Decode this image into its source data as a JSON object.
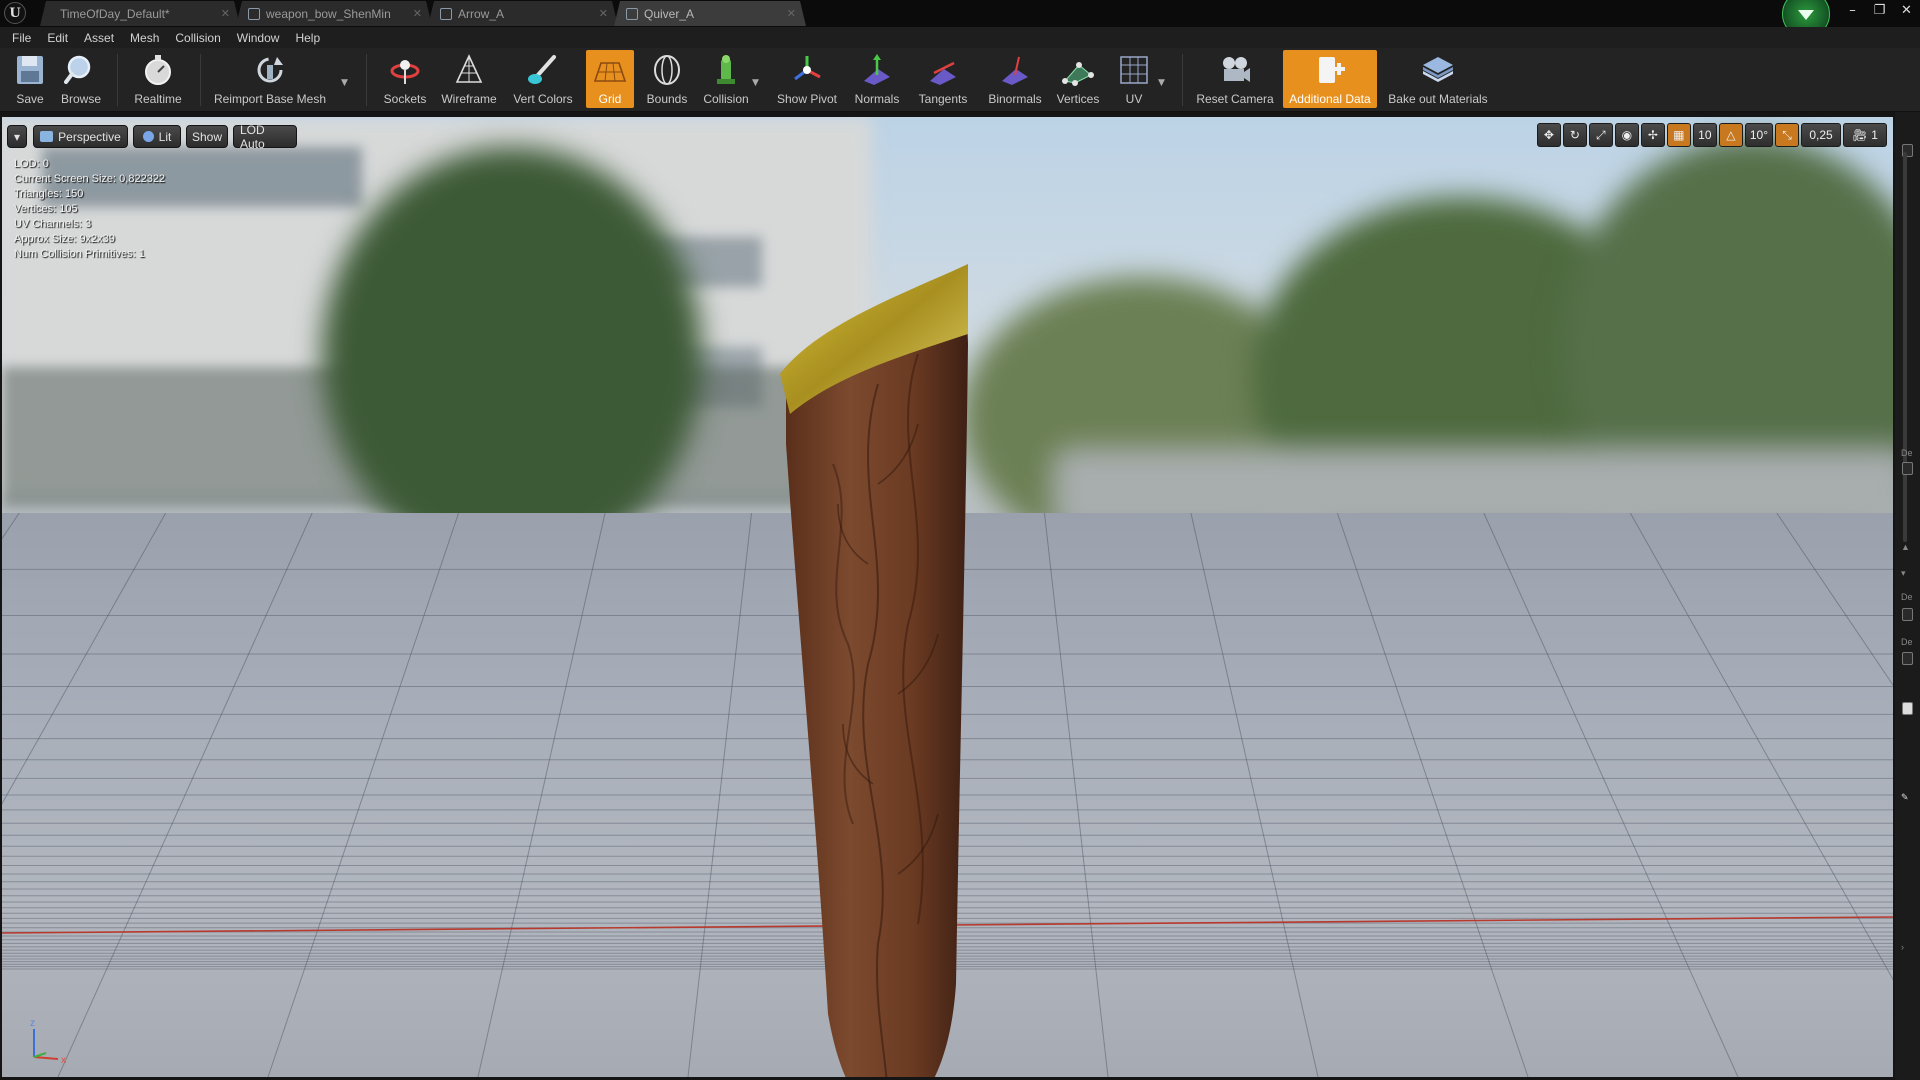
{
  "tabs": [
    {
      "label": "TimeOfDay_Default*",
      "active": false
    },
    {
      "label": "weapon_bow_ShenMin",
      "active": false
    },
    {
      "label": "Arrow_A",
      "active": false
    },
    {
      "label": "Quiver_A",
      "active": true
    }
  ],
  "window_controls": {
    "minimize": "–",
    "restore": "❐",
    "close": "✕"
  },
  "menu": [
    "File",
    "Edit",
    "Asset",
    "Mesh",
    "Collision",
    "Window",
    "Help"
  ],
  "toolbar": {
    "save": "Save",
    "browse": "Browse",
    "realtime": "Realtime",
    "reimport": "Reimport Base Mesh",
    "sockets": "Sockets",
    "wireframe": "Wireframe",
    "vert_colors": "Vert Colors",
    "grid": "Grid",
    "bounds": "Bounds",
    "collision": "Collision",
    "show_pivot": "Show Pivot",
    "normals": "Normals",
    "tangents": "Tangents",
    "binormals": "Binormals",
    "vertices": "Vertices",
    "uv": "UV",
    "reset_camera": "Reset Camera",
    "additional_data": "Additional Data",
    "bake_out_materials": "Bake out Materials"
  },
  "active_toggles": [
    "grid",
    "additional_data"
  ],
  "viewport": {
    "perspective": "Perspective",
    "lit": "Lit",
    "show": "Show",
    "lod": "LOD Auto",
    "grid_snap": "10",
    "rotation_snap": "10°",
    "scale_snap": "0,25",
    "camera_speed": "1"
  },
  "stats": [
    {
      "label": "LOD:",
      "value": "0"
    },
    {
      "label": "Current Screen Size:",
      "value": "0,822322"
    },
    {
      "label": "Triangles:",
      "value": "150"
    },
    {
      "label": "Vertices:",
      "value": "105"
    },
    {
      "label": "UV Channels:",
      "value": "3"
    },
    {
      "label": "Approx Size:",
      "value": "9x2x39"
    },
    {
      "label": "Num Collision Primitives:",
      "value": "1"
    }
  ],
  "axis": {
    "z": "z",
    "x": "x"
  },
  "colors": {
    "accent_orange": "#e8901d",
    "toolbar_bg": "#232323",
    "axis_x": "#b83a2e",
    "axis_y": "#3a8a2e",
    "quiver_wood": "#6b3a22",
    "quiver_trim": "#c7b02c"
  }
}
